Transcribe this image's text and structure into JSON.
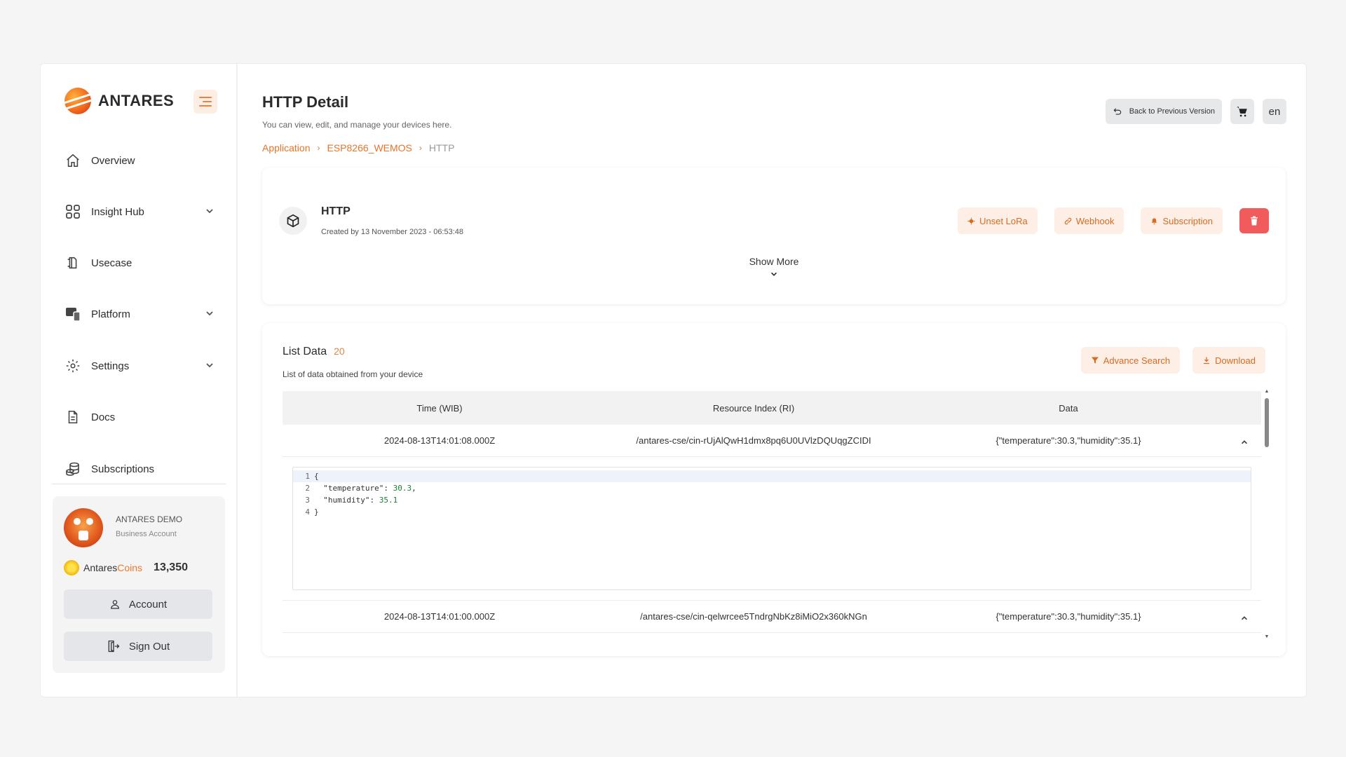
{
  "brand": {
    "name": "ANTARES"
  },
  "sidebar": {
    "items": [
      {
        "label": "Overview"
      },
      {
        "label": "Insight Hub"
      },
      {
        "label": "Usecase"
      },
      {
        "label": "Platform"
      },
      {
        "label": "Settings"
      },
      {
        "label": "Docs"
      },
      {
        "label": "Subscriptions"
      }
    ]
  },
  "profile": {
    "name": "ANTARES DEMO",
    "account_type": "Business Account",
    "coins_brand_prefix": "Antares",
    "coins_brand_suffix": "Coins",
    "coins_value": "13,350",
    "account_label": "Account",
    "signout_label": "Sign Out"
  },
  "header": {
    "title": "HTTP Detail",
    "subtitle": "You can view, edit, and manage your devices here.",
    "back_label": "Back to Previous Version",
    "language": "en"
  },
  "breadcrumb": [
    "Application",
    "ESP8266_WEMOS",
    "HTTP"
  ],
  "device": {
    "name": "HTTP",
    "created": "Created by 13 November 2023 - 06:53:48",
    "actions": {
      "unset_lora": "Unset LoRa",
      "webhook": "Webhook",
      "subscription": "Subscription"
    },
    "show_more": "Show More"
  },
  "list": {
    "title": "List Data",
    "count": "20",
    "subtitle": "List of data obtained from your device",
    "advance_search": "Advance Search",
    "download": "Download",
    "columns": [
      "Time (WIB)",
      "Resource Index (RI)",
      "Data"
    ],
    "rows": [
      {
        "time": "2024-08-13T14:01:08.000Z",
        "ri": "/antares-cse/cin-rUjAlQwH1dmx8pq6U0UVlzDQUqgZCIDI",
        "data": "{\"temperature\":30.3,\"humidity\":35.1}"
      },
      {
        "time": "2024-08-13T14:01:00.000Z",
        "ri": "/antares-cse/cin-qelwrcee5TndrgNbKz8iMiO2x360kNGn",
        "data": "{\"temperature\":30.3,\"humidity\":35.1}"
      }
    ],
    "code": {
      "line_numbers": [
        "1",
        "2",
        "3",
        "4"
      ],
      "open_brace": "{",
      "temp_key": "\"temperature\"",
      "temp_value": "30.3",
      "hum_key": "\"humidity\"",
      "hum_value": "35.1",
      "close_brace": "}"
    }
  },
  "colors": {
    "accent": "#e67429",
    "accent_bg": "#fdefe6",
    "danger": "#f25b5b"
  }
}
